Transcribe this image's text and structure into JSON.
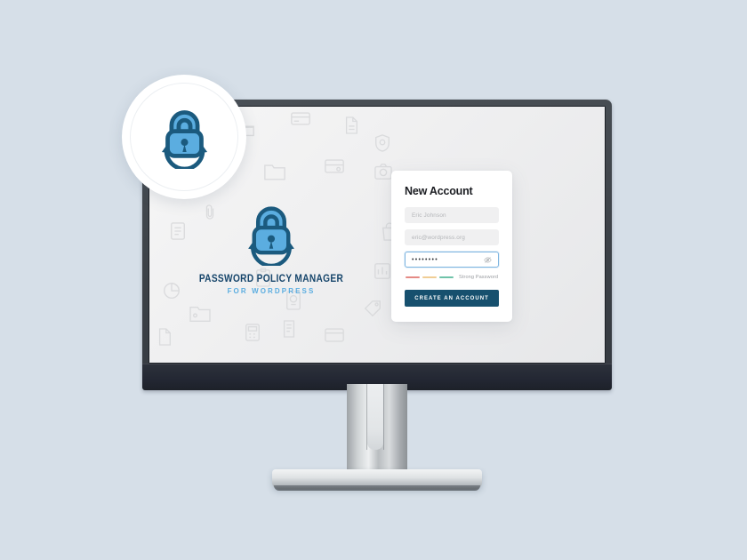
{
  "scene": {
    "background_color": "#d6dfe8",
    "device": "desktop-monitor",
    "bezel_color": "#3c4147",
    "chin_color": "#232733",
    "stand_color": "#cfd3d5"
  },
  "badge": {
    "icon_name": "padlock-refresh-icon",
    "lock_body_color": "#5bade0",
    "lock_outline_color": "#1b5a7e",
    "circle_color": "#ffffff"
  },
  "screen_logo": {
    "icon_name": "padlock-refresh-icon",
    "title": "PASSWORD POLICY MANAGER",
    "subtitle": "FOR WORDPRESS",
    "title_color": "#16456b",
    "subtitle_color": "#5bade0"
  },
  "form": {
    "title": "New Account",
    "name_field": {
      "placeholder": "Eric Johnson",
      "value": ""
    },
    "email_field": {
      "placeholder": "eric@wordpress.org",
      "value": ""
    },
    "password_field": {
      "value": "••••••••",
      "masked_length": 8,
      "focused": true,
      "toggle_icon": "eye-slash-icon",
      "border_color": "#7cb4e0"
    },
    "strength": {
      "label": "Strong Password",
      "segments": [
        {
          "name": "weak",
          "color": "#e58a85"
        },
        {
          "name": "medium",
          "color": "#f0cd95"
        },
        {
          "name": "strong",
          "color": "#6fc3a9"
        }
      ]
    },
    "submit_label": "CREATE AN ACCOUNT",
    "submit_color": "#17506e"
  }
}
